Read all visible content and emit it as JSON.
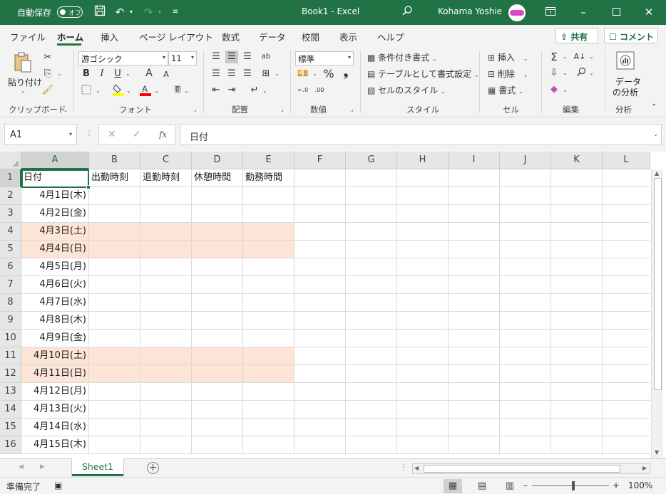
{
  "titlebar": {
    "autosave_label": "自動保存",
    "autosave_state": "オフ",
    "doc_title": "Book1  -  Excel",
    "user_name": "Kohama Yoshie"
  },
  "tabs": [
    "ファイル",
    "ホーム",
    "挿入",
    "ページ レイアウト",
    "数式",
    "データ",
    "校閲",
    "表示",
    "ヘルプ"
  ],
  "share_label": "共有",
  "comment_label": "コメント",
  "ribbon": {
    "paste_label": "貼り付け",
    "font_name": "游ゴシック",
    "font_size": "11",
    "number_format": "標準",
    "conditional_format": "条件付き書式",
    "format_as_table": "テーブルとして書式設定",
    "cell_styles": "セルのスタイル",
    "insert": "挿入",
    "delete": "削除",
    "format": "書式",
    "data_analysis_1": "データ",
    "data_analysis_2": "の分析",
    "groups": {
      "clipboard": "クリップボード",
      "font": "フォント",
      "alignment": "配置",
      "number": "数値",
      "styles": "スタイル",
      "cells": "セル",
      "editing": "編集",
      "analysis": "分析"
    },
    "bold": "B",
    "italic": "I",
    "underline": "U",
    "font_grow": "A",
    "font_shrink": "A",
    "percent": "%",
    "comma": "❟",
    "wrap_text": "ab",
    "dec_inc": "←.0",
    "dec_dec": ".00",
    "phonetic": "亜"
  },
  "formula_bar": {
    "name_box": "A1",
    "formula": "日付",
    "fx": "fx"
  },
  "grid": {
    "columns": [
      "A",
      "B",
      "C",
      "D",
      "E",
      "F",
      "G",
      "H",
      "I",
      "J",
      "K",
      "L"
    ],
    "rows": [
      "1",
      "2",
      "3",
      "4",
      "5",
      "6",
      "7",
      "8",
      "9",
      "10",
      "11",
      "12",
      "13",
      "14",
      "15",
      "16"
    ],
    "header_row": [
      "日付",
      "出勤時刻",
      "退勤時刻",
      "休憩時間",
      "勤務時間"
    ],
    "dates": [
      "4月1日(木)",
      "4月2日(金)",
      "4月3日(土)",
      "4月4日(日)",
      "4月5日(月)",
      "4月6日(火)",
      "4月7日(水)",
      "4月8日(木)",
      "4月9日(金)",
      "4月10日(土)",
      "4月11日(日)",
      "4月12日(月)",
      "4月13日(火)",
      "4月14日(水)",
      "4月15日(木)"
    ],
    "weekend_rows": [
      4,
      5,
      11,
      12
    ],
    "highlight_color": "#fce4d6"
  },
  "sheet_tab": "Sheet1",
  "status": {
    "ready": "準備完了",
    "zoom": "100%"
  },
  "colors": {
    "accent": "#217346"
  }
}
